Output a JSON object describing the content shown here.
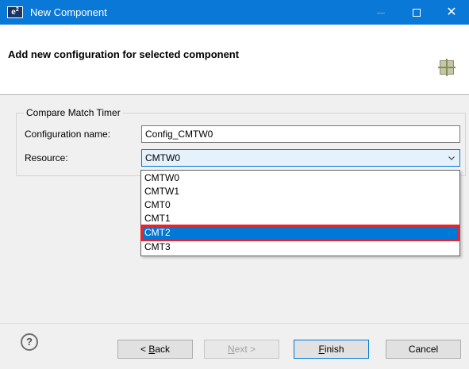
{
  "window": {
    "app_icon_text": "e",
    "app_icon_sup": "2",
    "title": "New Component",
    "title_color": "#0a78d7"
  },
  "header": {
    "title": "Add new configuration for selected component",
    "icon": "component-grid-icon"
  },
  "group": {
    "legend": "Compare Match Timer",
    "config_name_label": "Configuration name:",
    "config_name_value": "Config_CMTW0",
    "resource_label": "Resource:",
    "resource_value": "CMTW0"
  },
  "dropdown": {
    "options": [
      "CMTW0",
      "CMTW1",
      "CMT0",
      "CMT1",
      "CMT2",
      "CMT3"
    ],
    "selected_index": 4,
    "selected_color": "#0078d7",
    "highlight_color": "#e2262e"
  },
  "footer": {
    "help_icon_text": "?",
    "back_prefix": "< ",
    "back_underline": "B",
    "back_rest": "ack",
    "next_underline": "N",
    "next_rest": "ext >",
    "finish_underline": "F",
    "finish_rest": "inish",
    "cancel_label": "Cancel"
  }
}
